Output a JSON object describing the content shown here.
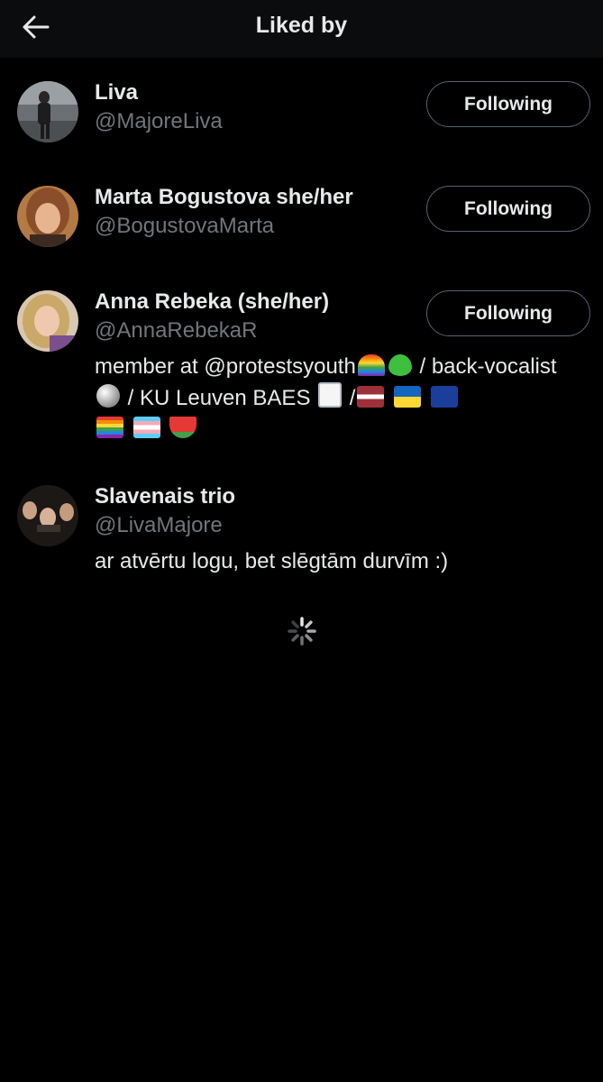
{
  "header": {
    "title": "Liked by",
    "back_icon": "arrow-left-icon"
  },
  "users": [
    {
      "name": "Liva",
      "handle": "@MajoreLiva",
      "button": "Following"
    },
    {
      "name": "Marta Bogustova she/her",
      "handle": "@BogustovaMarta",
      "button": "Following"
    },
    {
      "name": "Anna Rebeka (she/her)",
      "handle": "@AnnaRebekaR",
      "button": "Following",
      "bio": {
        "part1": "member at @protestsyouth",
        "part2": " / back-vocalist ",
        "part3": " / KU Leuven BAES ",
        "part4": " /"
      }
    },
    {
      "name": "Slavenais trio",
      "handle": "@LivaMajore",
      "bio_text": "ar atvērtu logu, bet slēgtām durvīm :)"
    }
  ],
  "colors": {
    "background": "#000000",
    "primary_text": "#e7e9ea",
    "secondary_text": "#71767b",
    "button_border": "#536471"
  },
  "loading": "spinner-icon"
}
